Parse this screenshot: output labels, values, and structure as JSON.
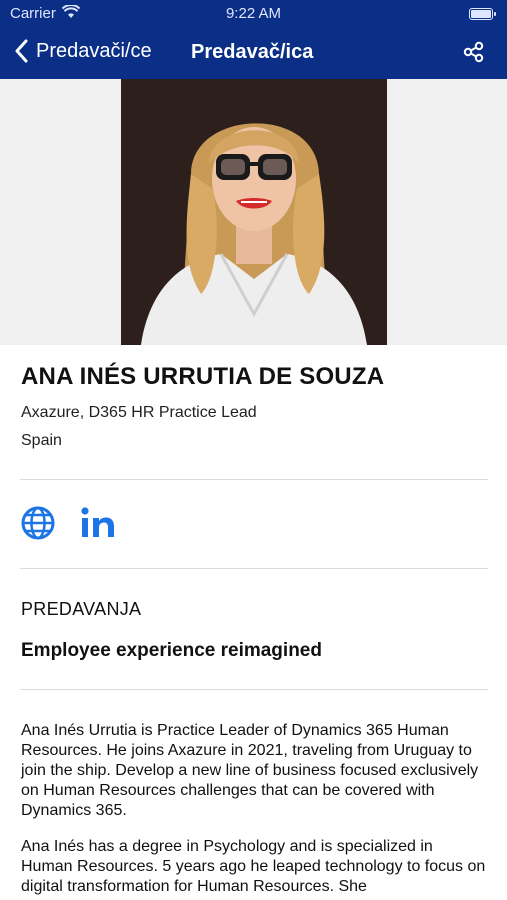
{
  "status_bar": {
    "carrier": "Carrier",
    "time": "9:22 AM"
  },
  "nav": {
    "back_label": "Predavači/ce",
    "title": "Predavač/ica"
  },
  "speaker": {
    "name": "ANA INÉS URRUTIA DE SOUZA",
    "role": "Axazure, D365 HR Practice Lead",
    "country": "Spain"
  },
  "talks": {
    "heading": "PREDAVANJA",
    "items": [
      {
        "title": "Employee experience reimagined"
      }
    ]
  },
  "bio": {
    "paragraphs": [
      "Ana Inés Urrutia is Practice Leader of Dynamics 365 Human Resources. He joins Axazure in 2021, traveling from Uruguay to join the ship. Develop a new line of business focused exclusively on Human Resources challenges that can be covered with Dynamics 365.",
      "Ana Inés has a degree in Psychology and is specialized in Human Resources. 5 years ago he leaped technology to focus on digital transformation for Human Resources. She"
    ]
  },
  "colors": {
    "nav_background": "#0b2f86",
    "link_icon": "#1c74e6"
  },
  "icons": {
    "back": "chevron-left-icon",
    "share": "share-icon",
    "website": "globe-icon",
    "linkedin": "linkedin-icon"
  }
}
